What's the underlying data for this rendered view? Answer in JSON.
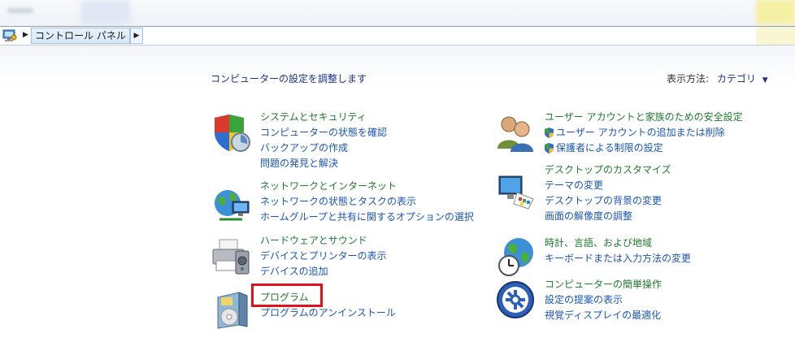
{
  "address": {
    "crumb": "コントロール パネル"
  },
  "header": {
    "title": "コンピューターの設定を調整します",
    "view_label": "表示方法:",
    "view_value": "カテゴリ"
  },
  "left": [
    {
      "title": "システムとセキュリティ",
      "links": [
        "コンピューターの状態を確認",
        "バックアップの作成",
        "問題の発見と解決"
      ]
    },
    {
      "title": "ネットワークとインターネット",
      "links": [
        "ネットワークの状態とタスクの表示",
        "ホームグループと共有に関するオプションの選択"
      ]
    },
    {
      "title": "ハードウェアとサウンド",
      "links": [
        "デバイスとプリンターの表示",
        "デバイスの追加"
      ]
    },
    {
      "title": "プログラム",
      "links": [
        "プログラムのアンインストール"
      ]
    }
  ],
  "right": [
    {
      "title": "ユーザー アカウントと家族のための安全設定",
      "links": [
        "ユーザー アカウントの追加または削除",
        "保護者による制限の設定"
      ]
    },
    {
      "title": "デスクトップのカスタマイズ",
      "links": [
        "テーマの変更",
        "デスクトップの背景の変更",
        "画面の解像度の調整"
      ]
    },
    {
      "title": "時計、言語、および地域",
      "links": [
        "キーボードまたは入力方法の変更"
      ]
    },
    {
      "title": "コンピューターの簡単操作",
      "links": [
        "設定の提案の表示",
        "視覚ディスプレイの最適化"
      ]
    }
  ],
  "colors": {
    "title_green": "#1e7a2e",
    "link_blue": "#1a55b5",
    "highlight_red": "#e0101d"
  },
  "icons": {
    "address": "control-panel-icon",
    "left": [
      "security-shield-icon",
      "network-globe-icon",
      "printer-icon",
      "program-box-icon"
    ],
    "right": [
      "users-icon",
      "display-palette-icon",
      "globe-clock-icon",
      "ease-of-access-icon"
    ]
  }
}
